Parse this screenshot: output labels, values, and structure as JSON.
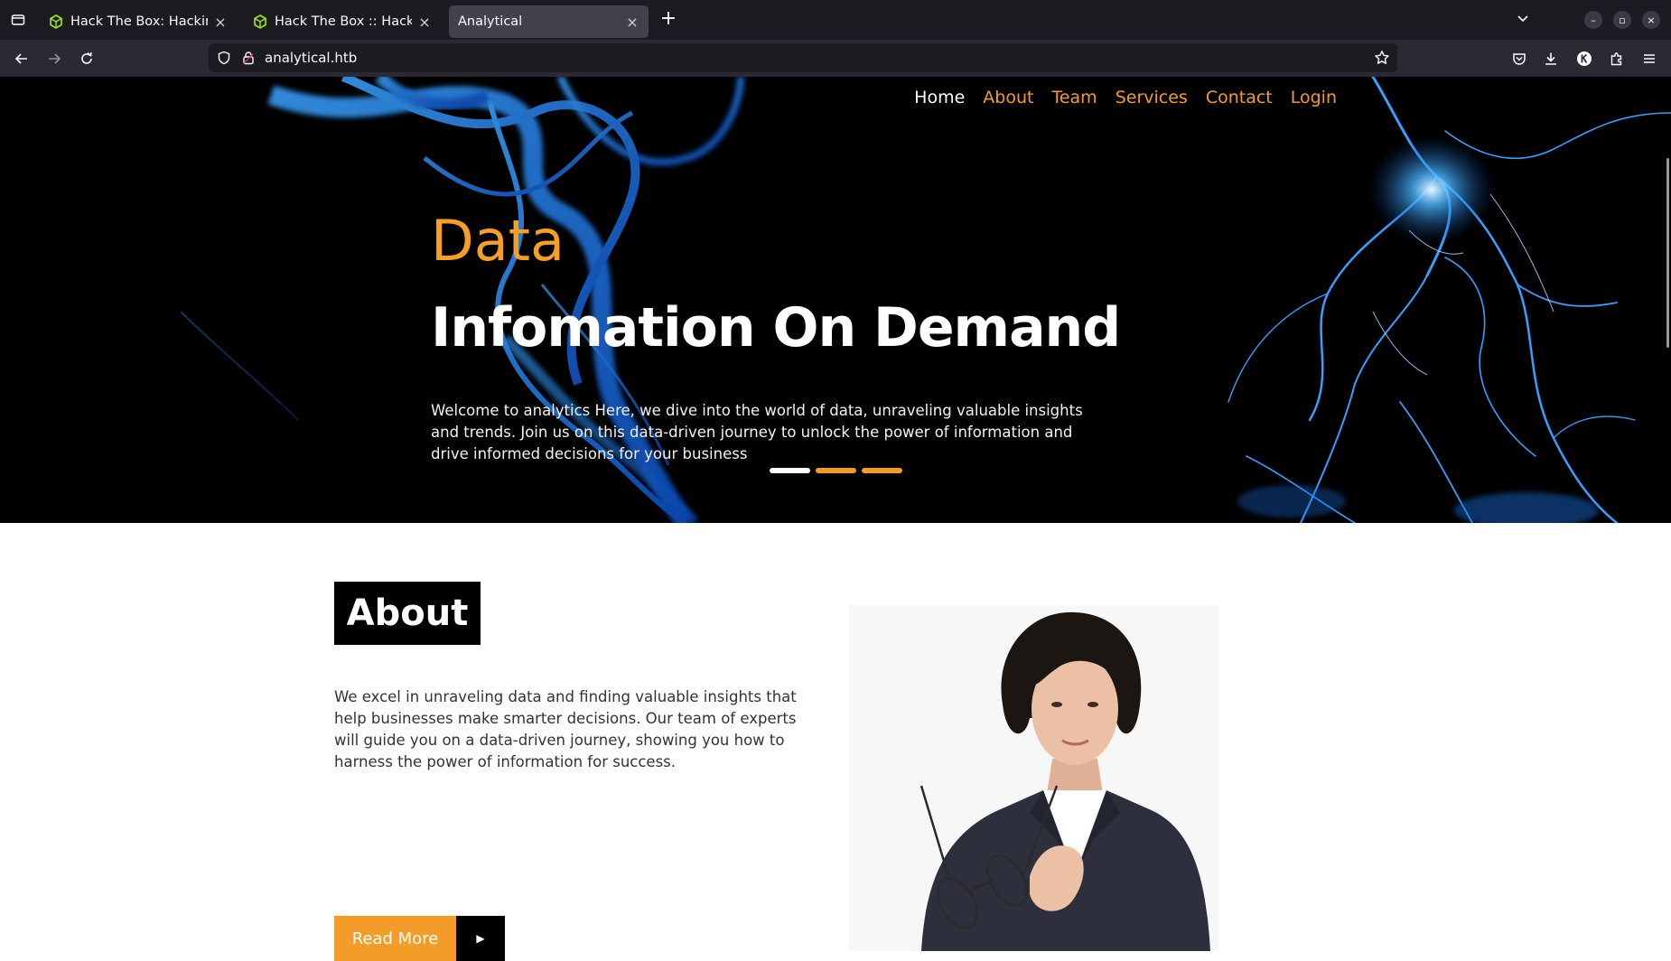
{
  "browser": {
    "tabs": [
      {
        "title": "Hack The Box: Hacking Tr",
        "active": false
      },
      {
        "title": "Hack The Box :: Hack The",
        "active": false
      },
      {
        "title": "Analytical",
        "active": true
      }
    ],
    "url": "analytical.htb"
  },
  "site": {
    "nav": [
      "Home",
      "About",
      "Team",
      "Services",
      "Contact",
      "Login"
    ],
    "hero": {
      "kicker": "Data",
      "title": "Infomation On Demand",
      "text": "Welcome to analytics Here, we dive into the world of data, unraveling valuable insights and trends. Join us on this data-driven journey to unlock the power of information and drive informed decisions for your business"
    },
    "about": {
      "title": "About",
      "text": "We excel in unraveling data and finding valuable insights that help businesses make smarter decisions. Our team of experts will guide you on a data-driven journey, showing you how to harness the power of information for success.",
      "button": "Read More"
    }
  },
  "colors": {
    "accent": "#f39c2a",
    "hero_bg": "#000000",
    "glow": "#2f8fff"
  }
}
